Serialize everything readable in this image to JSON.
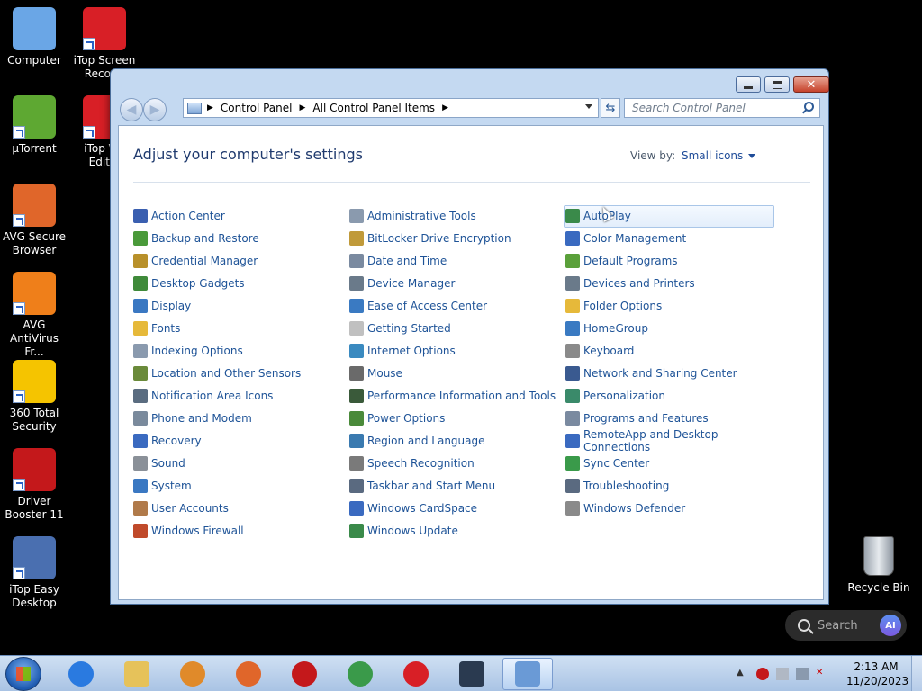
{
  "desktop": {
    "icons": [
      {
        "label": "Computer",
        "icon": "computer-icon",
        "color": "#6aa6e6"
      },
      {
        "label": "iTop Screen Recor...",
        "icon": "itop-screen-recorder-icon",
        "color": "#d81f26"
      },
      {
        "label": "μTorrent",
        "icon": "utorrent-icon",
        "color": "#5ea832"
      },
      {
        "label": "iTop V... Edit...",
        "icon": "itop-video-editor-icon",
        "color": "#d81f26"
      },
      {
        "label": "AVG Secure Browser",
        "icon": "avg-secure-browser-icon",
        "color": "#e0662a"
      },
      {
        "label": "AVG AntiVirus Fr...",
        "icon": "avg-antivirus-icon",
        "color": "#ef7f1a"
      },
      {
        "label": "360 Total Security",
        "icon": "360-total-security-icon",
        "color": "#f5c400"
      },
      {
        "label": "Driver Booster 11",
        "icon": "driver-booster-icon",
        "color": "#c4181b"
      },
      {
        "label": "iTop Easy Desktop",
        "icon": "itop-easy-desktop-icon",
        "color": "#4a6fb0"
      }
    ],
    "recycle_bin": "Recycle Bin",
    "search_placeholder": "Search",
    "ai_label": "AI"
  },
  "window": {
    "breadcrumb": [
      "Control Panel",
      "All Control Panel Items"
    ],
    "search_placeholder": "Search Control Panel",
    "heading": "Adjust your computer's settings",
    "view_by_label": "View by:",
    "view_by_value": "Small icons",
    "columns": [
      [
        {
          "label": "Action Center",
          "icon": "action-center-icon",
          "color": "#3a5fb0"
        },
        {
          "label": "Backup and Restore",
          "icon": "backup-restore-icon",
          "color": "#4a9a3a"
        },
        {
          "label": "Credential Manager",
          "icon": "credential-manager-icon",
          "color": "#b8902a"
        },
        {
          "label": "Desktop Gadgets",
          "icon": "desktop-gadgets-icon",
          "color": "#3f8a3a"
        },
        {
          "label": "Display",
          "icon": "display-icon",
          "color": "#3a78c2"
        },
        {
          "label": "Fonts",
          "icon": "fonts-icon",
          "color": "#e6b93a"
        },
        {
          "label": "Indexing Options",
          "icon": "indexing-options-icon",
          "color": "#8a9aae"
        },
        {
          "label": "Location and Other Sensors",
          "icon": "location-sensors-icon",
          "color": "#6a8a3a"
        },
        {
          "label": "Notification Area Icons",
          "icon": "notification-area-icon",
          "color": "#5a6c80"
        },
        {
          "label": "Phone and Modem",
          "icon": "phone-modem-icon",
          "color": "#7a8a9c"
        },
        {
          "label": "Recovery",
          "icon": "recovery-icon",
          "color": "#3a6ac0"
        },
        {
          "label": "Sound",
          "icon": "sound-icon",
          "color": "#8a9098"
        },
        {
          "label": "System",
          "icon": "system-icon",
          "color": "#3a78c2"
        },
        {
          "label": "User Accounts",
          "icon": "user-accounts-icon",
          "color": "#b07a4a"
        },
        {
          "label": "Windows Firewall",
          "icon": "windows-firewall-icon",
          "color": "#c04a2a"
        }
      ],
      [
        {
          "label": "Administrative Tools",
          "icon": "administrative-tools-icon",
          "color": "#8a9aae"
        },
        {
          "label": "BitLocker Drive Encryption",
          "icon": "bitlocker-icon",
          "color": "#c09a3a"
        },
        {
          "label": "Date and Time",
          "icon": "date-time-icon",
          "color": "#7a8aa0"
        },
        {
          "label": "Device Manager",
          "icon": "device-manager-icon",
          "color": "#6a7a8a"
        },
        {
          "label": "Ease of Access Center",
          "icon": "ease-of-access-icon",
          "color": "#3a7ac2"
        },
        {
          "label": "Getting Started",
          "icon": "getting-started-icon",
          "color": "#c0c0c0"
        },
        {
          "label": "Internet Options",
          "icon": "internet-options-icon",
          "color": "#3a8ac0"
        },
        {
          "label": "Mouse",
          "icon": "mouse-icon",
          "color": "#6a6a6a"
        },
        {
          "label": "Performance Information and Tools",
          "icon": "performance-icon",
          "color": "#3a5a3a"
        },
        {
          "label": "Power Options",
          "icon": "power-options-icon",
          "color": "#4a8a3a"
        },
        {
          "label": "Region and Language",
          "icon": "region-language-icon",
          "color": "#3a7ab0"
        },
        {
          "label": "Speech Recognition",
          "icon": "speech-recognition-icon",
          "color": "#7a7a7a"
        },
        {
          "label": "Taskbar and Start Menu",
          "icon": "taskbar-start-menu-icon",
          "color": "#5a6a80"
        },
        {
          "label": "Windows CardSpace",
          "icon": "cardspace-icon",
          "color": "#3a6ac0"
        },
        {
          "label": "Windows Update",
          "icon": "windows-update-icon",
          "color": "#3a8a4a"
        }
      ],
      [
        {
          "label": "AutoPlay",
          "icon": "autoplay-icon",
          "color": "#3a8a4a"
        },
        {
          "label": "Color Management",
          "icon": "color-management-icon",
          "color": "#3a6ac0"
        },
        {
          "label": "Default Programs",
          "icon": "default-programs-icon",
          "color": "#5aa03a"
        },
        {
          "label": "Devices and Printers",
          "icon": "devices-printers-icon",
          "color": "#6a7a8a"
        },
        {
          "label": "Folder Options",
          "icon": "folder-options-icon",
          "color": "#e6b93a"
        },
        {
          "label": "HomeGroup",
          "icon": "homegroup-icon",
          "color": "#3a7ac2"
        },
        {
          "label": "Keyboard",
          "icon": "keyboard-icon",
          "color": "#8a8a8a"
        },
        {
          "label": "Network and Sharing Center",
          "icon": "network-sharing-icon",
          "color": "#3a5a90"
        },
        {
          "label": "Personalization",
          "icon": "personalization-icon",
          "color": "#3a8a6a"
        },
        {
          "label": "Programs and Features",
          "icon": "programs-features-icon",
          "color": "#7a8aa0"
        },
        {
          "label": "RemoteApp and Desktop Connections",
          "icon": "remoteapp-icon",
          "color": "#3a6ac0"
        },
        {
          "label": "Sync Center",
          "icon": "sync-center-icon",
          "color": "#3a9a4a"
        },
        {
          "label": "Troubleshooting",
          "icon": "troubleshooting-icon",
          "color": "#5a6a80"
        },
        {
          "label": "Windows Defender",
          "icon": "windows-defender-icon",
          "color": "#8a8a8a"
        }
      ]
    ]
  },
  "taskbar": {
    "pinned": [
      {
        "icon": "internet-explorer-icon",
        "color": "#2a7ae0"
      },
      {
        "icon": "windows-explorer-icon",
        "color": "#e6c25a"
      },
      {
        "icon": "media-player-icon",
        "color": "#e08a2a"
      },
      {
        "icon": "avg-secure-browser-taskbar-icon",
        "color": "#e0662a"
      },
      {
        "icon": "driver-booster-taskbar-icon",
        "color": "#c4181b"
      },
      {
        "icon": "chrome-icon",
        "color": "#3a9a4a"
      },
      {
        "icon": "itop-screen-recorder-taskbar-icon",
        "color": "#d81f26"
      },
      {
        "icon": "itop-easy-desktop-taskbar-icon",
        "color": "#2a3a50"
      },
      {
        "icon": "control-panel-taskbar-icon",
        "color": "#6a9ad6"
      }
    ],
    "time": "2:13 AM",
    "date": "11/20/2023"
  }
}
